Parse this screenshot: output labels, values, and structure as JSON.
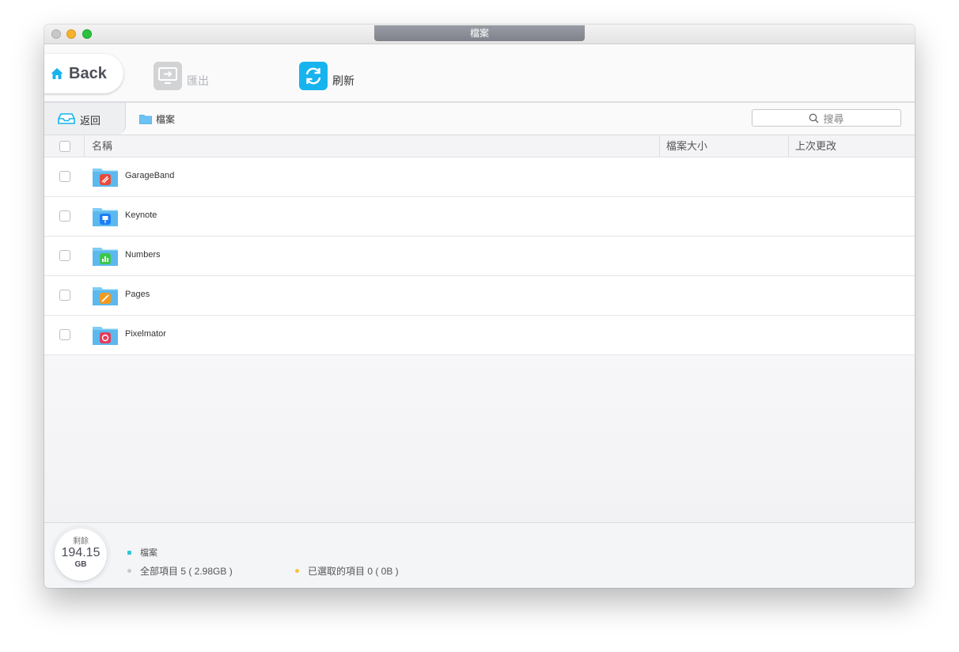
{
  "window": {
    "title": "檔案"
  },
  "toolbar": {
    "back_label": "Back",
    "export_label": "匯出",
    "refresh_label": "刷新"
  },
  "pathbar": {
    "back_label": "返回",
    "crumb": "檔案",
    "search_placeholder": "搜尋"
  },
  "table": {
    "columns": {
      "name": "名稱",
      "size": "檔案大小",
      "modified": "上次更改"
    },
    "rows": [
      {
        "name": "GarageBand",
        "icon": "garageband-icon",
        "color": "#e8493a"
      },
      {
        "name": "Keynote",
        "icon": "keynote-icon",
        "color": "#1b7ef5"
      },
      {
        "name": "Numbers",
        "icon": "numbers-icon",
        "color": "#3cc74a"
      },
      {
        "name": "Pages",
        "icon": "pages-icon",
        "color": "#f39a1f"
      },
      {
        "name": "Pixelmator",
        "icon": "pixelmator-icon",
        "color": "#e53c5a"
      }
    ]
  },
  "footer": {
    "gauge_label": "剩餘",
    "gauge_value": "194.15",
    "gauge_unit": "GB",
    "category": "檔案",
    "total_items": "全部項目 5 ( 2.98GB )",
    "selected_items": "已選取的項目 0 ( 0B )"
  },
  "colors": {
    "accent": "#17b3ef",
    "category_dot": "#2ec7d6",
    "selected_dot": "#f5c33b",
    "total_dot": "#c8c8c8"
  }
}
